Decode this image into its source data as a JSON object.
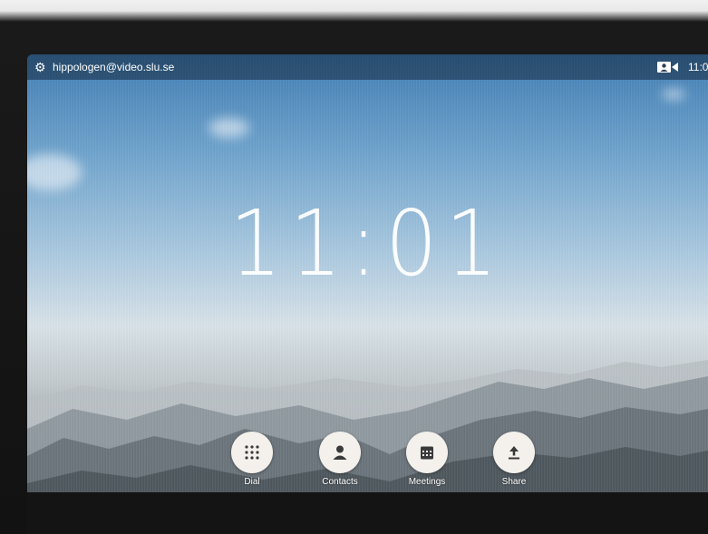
{
  "status_bar": {
    "account": "hippologen@video.slu.se",
    "time": "11:0"
  },
  "clock": {
    "time": "11:01"
  },
  "actions": [
    {
      "label": "Dial",
      "icon": "dialpad-icon"
    },
    {
      "label": "Contacts",
      "icon": "person-icon"
    },
    {
      "label": "Meetings",
      "icon": "calendar-icon"
    },
    {
      "label": "Share",
      "icon": "upload-icon"
    }
  ],
  "colors": {
    "button_bg": "#f4f1ec",
    "icon": "#3a3a3a",
    "status_bar_bg": "#14283c"
  }
}
